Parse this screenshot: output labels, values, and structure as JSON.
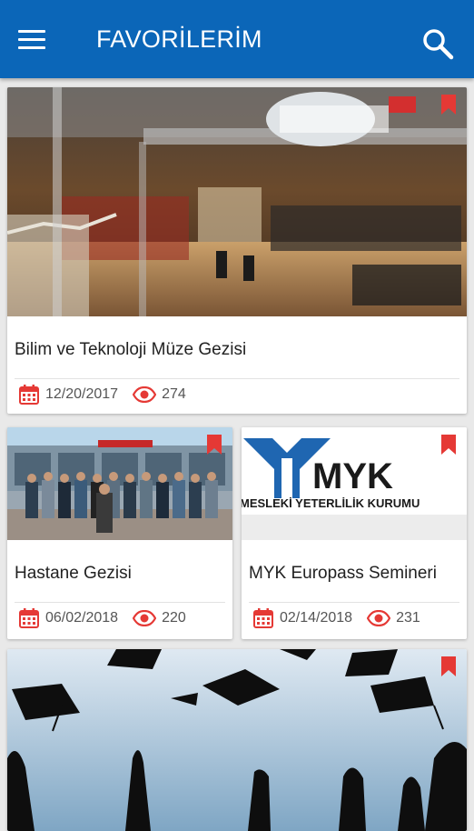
{
  "header": {
    "title": "FAVORİLERİM",
    "menu_icon": "menu-icon",
    "search_icon": "search-icon",
    "background": "#0b66b8"
  },
  "accent_color": "#e53935",
  "cards": [
    {
      "title": "Bilim ve Teknoloji Müze Gezisi",
      "date": "12/20/2017",
      "views": "274",
      "bookmarked": true
    },
    {
      "title": "Hastane Gezisi",
      "date": "06/02/2018",
      "views": "220",
      "bookmarked": true
    },
    {
      "title": "MYK Europass Semineri",
      "date": "02/14/2018",
      "views": "231",
      "bookmarked": true,
      "logo_text": "MYK",
      "logo_subtext": "MESLEKİ YETERLİLİK KURUMU"
    },
    {
      "bookmarked": true
    }
  ]
}
